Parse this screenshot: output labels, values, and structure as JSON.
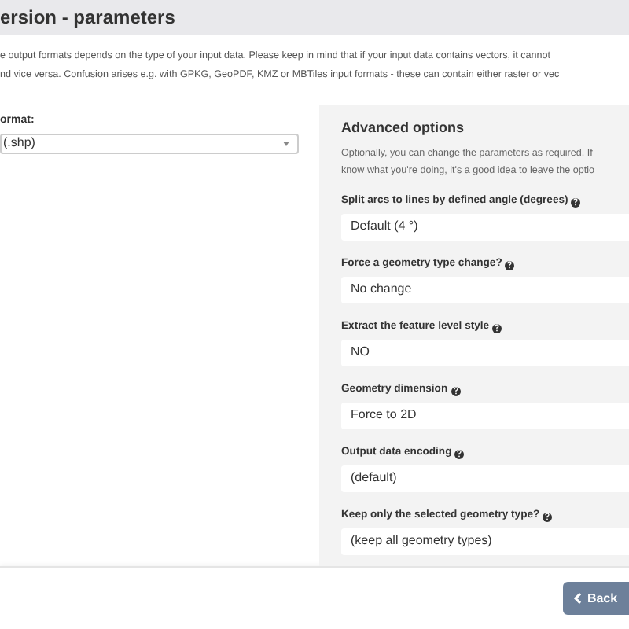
{
  "header": {
    "title": "ersion - parameters"
  },
  "intro": [
    "e output formats depends on the type of your input data. Please keep in mind that if your input data contains vectors, it cannot",
    "nd vice versa. Confusion arises e.g. with GPKG, GeoPDF, KMZ or MBTiles input formats - these can contain either raster or vec"
  ],
  "format": {
    "label": "ormat:",
    "value": "(.shp)"
  },
  "advanced": {
    "title": "Advanced options",
    "description": [
      "Optionally, you can change the parameters as required. If",
      "know what you're doing, it's a good idea to leave the optio"
    ],
    "fields": [
      {
        "label": "Split arcs to lines by defined angle (degrees)",
        "value": "Default (4 °)"
      },
      {
        "label": "Force a geometry type change?",
        "value": "No change"
      },
      {
        "label": "Extract the feature level style",
        "value": "NO"
      },
      {
        "label": "Geometry dimension",
        "value": "Force to 2D"
      },
      {
        "label": "Output data encoding",
        "value": "(default)"
      },
      {
        "label": "Keep only the selected geometry type?",
        "value": "(keep all geometry types)"
      }
    ]
  },
  "footer": {
    "back_button": "Back"
  }
}
